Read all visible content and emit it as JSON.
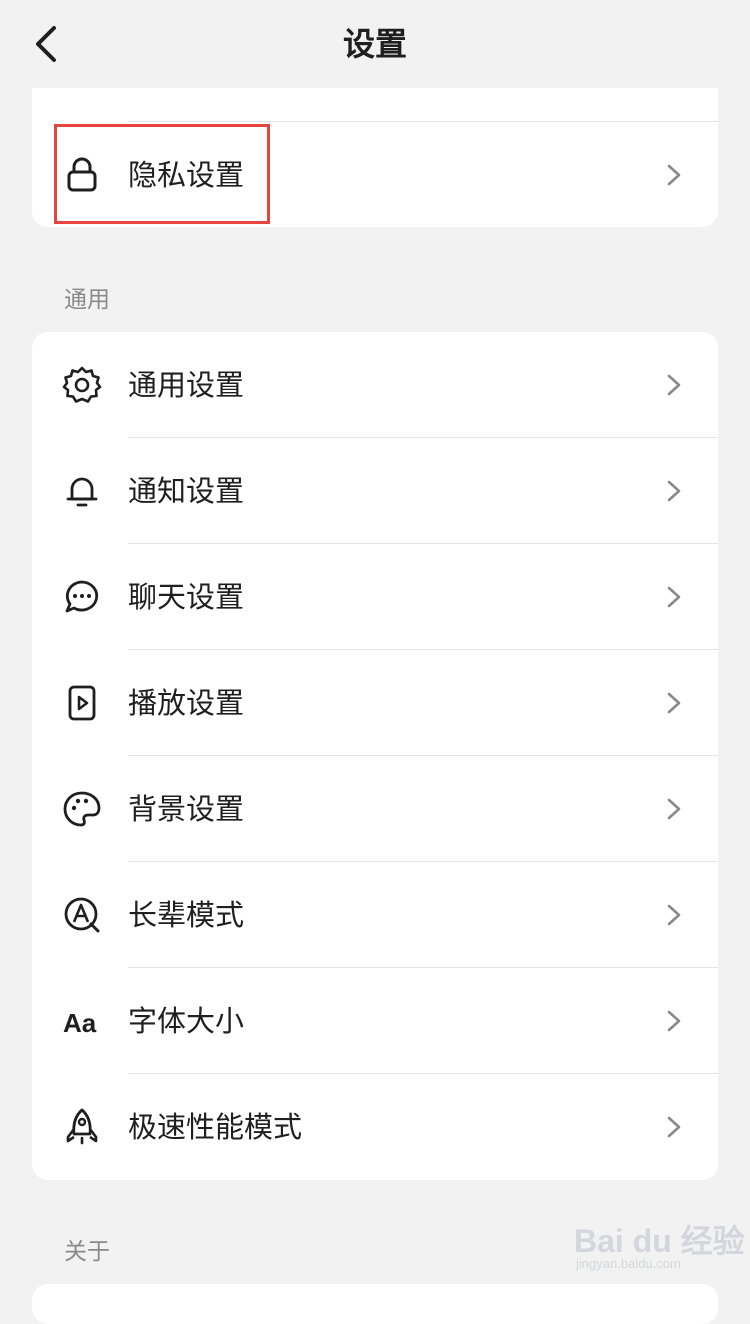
{
  "header": {
    "title": "设置",
    "back_icon": "chevron-left-icon"
  },
  "top_group": {
    "items": [
      {
        "label": "隐私设置",
        "icon": "lock-icon"
      }
    ]
  },
  "general_section": {
    "label": "通用",
    "items": [
      {
        "label": "通用设置",
        "icon": "gear-icon"
      },
      {
        "label": "通知设置",
        "icon": "bell-icon"
      },
      {
        "label": "聊天设置",
        "icon": "chat-bubble-icon"
      },
      {
        "label": "播放设置",
        "icon": "play-icon"
      },
      {
        "label": "背景设置",
        "icon": "palette-icon"
      },
      {
        "label": "长辈模式",
        "icon": "elder-mode-icon"
      },
      {
        "label": "字体大小",
        "icon": "font-size-icon",
        "icon_text": "Aa"
      },
      {
        "label": "极速性能模式",
        "icon": "rocket-icon"
      }
    ]
  },
  "about_section": {
    "label": "关于"
  },
  "watermark": {
    "main": "Bai du 经验",
    "sub": "jingyan.baidu.com"
  },
  "colors": {
    "highlight": "#e5453c",
    "background": "#f2f2f2",
    "card": "#ffffff"
  }
}
